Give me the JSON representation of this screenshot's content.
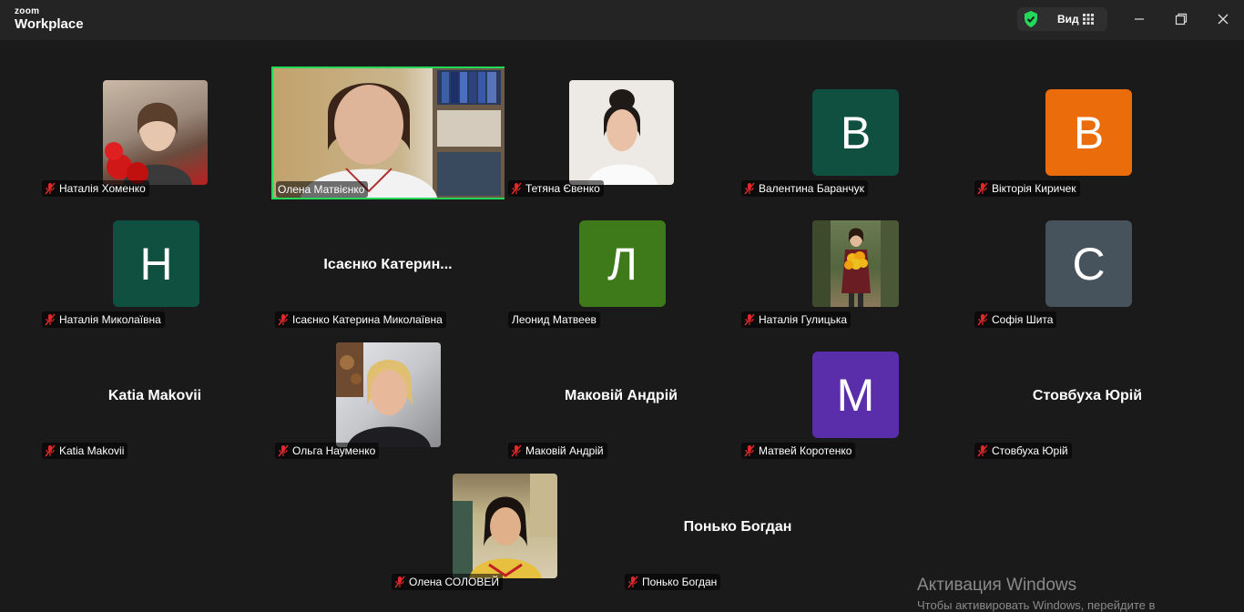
{
  "app": {
    "brand_small": "zoom",
    "brand_large": "Workplace",
    "view_label": "Вид",
    "shield_color": "#23d959"
  },
  "participants": [
    {
      "name": "Наталія Хоменко",
      "kind": "photo",
      "muted": true
    },
    {
      "name": "Олена Матвієнко",
      "kind": "video",
      "active_speaker": true,
      "muted": false
    },
    {
      "name": "Тетяна Євенко",
      "kind": "photo",
      "muted": true
    },
    {
      "name": "Валентина Баранчук",
      "kind": "avatar",
      "initial": "В",
      "color": "#0f5040",
      "muted": true
    },
    {
      "name": "Вікторія Киричек",
      "kind": "avatar",
      "initial": "В",
      "color": "#eb6c0a",
      "muted": true
    },
    {
      "name": "Наталія Миколаївна",
      "kind": "avatar",
      "initial": "Н",
      "color": "#0f5040",
      "muted": true
    },
    {
      "name": "Ісаєнко Катерина Миколаївна",
      "display": "Ісаєнко  Катерин...",
      "kind": "name",
      "muted": true
    },
    {
      "name": "Леонид Матвеев",
      "kind": "avatar",
      "initial": "Л",
      "color": "#3f7a1a",
      "muted": false
    },
    {
      "name": "Наталія Гулицька",
      "kind": "photo",
      "muted": true
    },
    {
      "name": "Софія Шита",
      "kind": "avatar",
      "initial": "С",
      "color": "#46535c",
      "muted": true
    },
    {
      "name": "Katia Makovii",
      "display": "Katia Makovii",
      "kind": "name",
      "muted": true
    },
    {
      "name": "Ольга Науменко",
      "kind": "photo",
      "muted": true
    },
    {
      "name": "Маковій Андрій",
      "display": "Маковій Андрій",
      "kind": "name",
      "muted": true
    },
    {
      "name": "Матвей Коротенко",
      "kind": "avatar",
      "initial": "М",
      "color": "#5a2dab",
      "muted": true
    },
    {
      "name": "Стовбуха Юрій",
      "display": "Стовбуха Юрій",
      "kind": "name",
      "muted": true
    },
    {
      "name": "Олена СОЛОВЕЙ",
      "kind": "photo",
      "muted": true
    },
    {
      "name": "Понько Богдан",
      "display": "Понько Богдан",
      "kind": "name",
      "muted": true
    }
  ],
  "watermark": {
    "title": "Активация Windows",
    "subtitle": "Чтобы активировать Windows, перейдите в"
  }
}
